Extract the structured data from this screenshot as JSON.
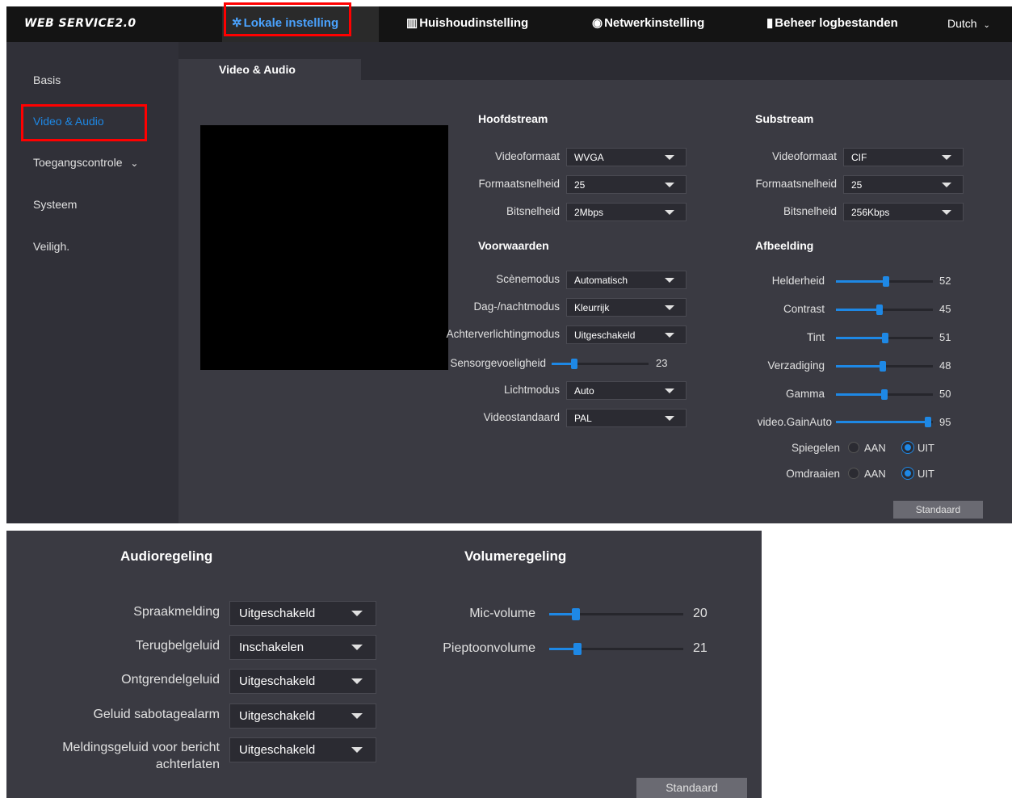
{
  "header": {
    "logo": "WEB SERVICE2.0",
    "nav": [
      {
        "icon": "gear-icon",
        "label": "Lokale instelling",
        "active": true
      },
      {
        "icon": "building-icon",
        "label": "Huishoudinstelling"
      },
      {
        "icon": "globe-icon",
        "label": "Netwerkinstelling"
      },
      {
        "icon": "document-icon",
        "label": "Beheer logbestanden"
      }
    ],
    "language": "Dutch",
    "language_caret": "⌄"
  },
  "sidebar": {
    "items": [
      {
        "label": "Basis"
      },
      {
        "label": "Video & Audio",
        "active": true
      },
      {
        "label": "Toegangscontrole",
        "caret": "⌄"
      },
      {
        "label": "Systeem"
      },
      {
        "label": "Veiligh."
      }
    ]
  },
  "tab": {
    "label": "Video & Audio"
  },
  "mainstream": {
    "title": "Hoofdstream",
    "fields": [
      {
        "label": "Videoformaat",
        "value": "WVGA"
      },
      {
        "label": "Formaatsnelheid",
        "value": "25"
      },
      {
        "label": "Bitsnelheid",
        "value": "2Mbps"
      }
    ]
  },
  "substream": {
    "title": "Substream",
    "fields": [
      {
        "label": "Videoformaat",
        "value": "CIF"
      },
      {
        "label": "Formaatsnelheid",
        "value": "25"
      },
      {
        "label": "Bitsnelheid",
        "value": "256Kbps"
      }
    ]
  },
  "conditions": {
    "title": "Voorwaarden",
    "scene": {
      "label": "Scènemodus",
      "value": "Automatisch"
    },
    "daynight": {
      "label": "Dag-/nachtmodus",
      "value": "Kleurrijk"
    },
    "backlight": {
      "label": "Achterverlichtingmodus",
      "value": "Uitgeschakeld"
    },
    "sensitivity": {
      "label": "Sensorgevoeligheid",
      "value": "23",
      "level": 0.23
    },
    "light": {
      "label": "Lichtmodus",
      "value": "Auto"
    },
    "standard": {
      "label": "Videostandaard",
      "value": "PAL"
    }
  },
  "image": {
    "title": "Afbeelding",
    "sliders": [
      {
        "label": "Helderheid",
        "value": "52",
        "level": 0.52
      },
      {
        "label": "Contrast",
        "value": "45",
        "level": 0.45
      },
      {
        "label": "Tint",
        "value": "51",
        "level": 0.51
      },
      {
        "label": "Verzadiging",
        "value": "48",
        "level": 0.48
      },
      {
        "label": "Gamma",
        "value": "50",
        "level": 0.5
      },
      {
        "label": "video.GainAuto",
        "value": "95",
        "level": 0.95
      }
    ],
    "mirror": {
      "label": "Spiegelen",
      "on": "AAN",
      "off": "UIT",
      "selected": "UIT"
    },
    "flip": {
      "label": "Omdraaien",
      "on": "AAN",
      "off": "UIT",
      "selected": "UIT"
    },
    "default_button": "Standaard"
  },
  "audio": {
    "title": "Audioregeling",
    "fields": [
      {
        "label": "Spraakmelding",
        "value": "Uitgeschakeld"
      },
      {
        "label": "Terugbelgeluid",
        "value": "Inschakelen"
      },
      {
        "label": "Ontgrendelgeluid",
        "value": "Uitgeschakeld"
      },
      {
        "label": "Geluid sabotagealarm",
        "value": "Uitgeschakeld"
      },
      {
        "label_line1": "Meldingsgeluid voor bericht",
        "label_line2": "achterlaten",
        "value": "Uitgeschakeld"
      }
    ]
  },
  "volume": {
    "title": "Volumeregeling",
    "mic": {
      "label": "Mic-volume",
      "value": "20",
      "level": 0.2
    },
    "beep": {
      "label": "Pieptoonvolume",
      "value": "21",
      "level": 0.21
    },
    "default_button": "Standaard"
  },
  "colors": {
    "accent": "#1e88e5",
    "highlight": "#ff0000",
    "topbar": "#141414",
    "panel": "#3a3a42"
  }
}
